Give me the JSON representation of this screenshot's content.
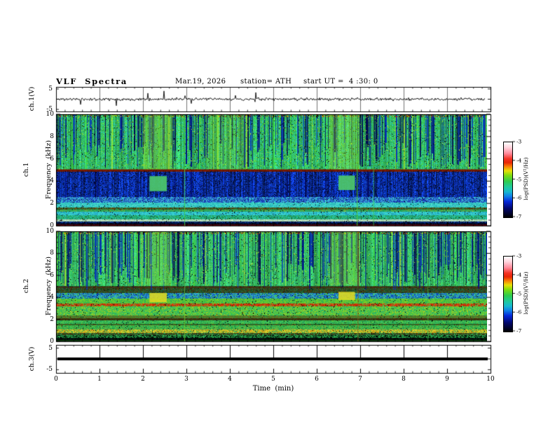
{
  "header": {
    "title": "VLF  Spectra",
    "date": "Mar.19, 2026",
    "station": "station= ATH",
    "start_ut": "start UT =  4 :30: 0"
  },
  "axes": {
    "time": {
      "label": "Time  (min)",
      "ticks": [
        0,
        1,
        2,
        3,
        4,
        5,
        6,
        7,
        8,
        9,
        10
      ],
      "minor_step": 0.2,
      "range": [
        0,
        10
      ]
    },
    "freq": {
      "ticks": [
        0,
        2,
        4,
        6,
        8,
        10
      ],
      "minor_step": 0.5,
      "range": [
        0,
        10
      ]
    },
    "volt": {
      "ticks": [
        5,
        -5
      ],
      "range": [
        -5,
        5
      ]
    },
    "wave_ylabel": "ch.1(V)",
    "spec1_ylabel1": "ch.1",
    "spec1_ylabel2": "Frequency  (kHz)",
    "spec2_ylabel1": "ch.2",
    "spec2_ylabel2": "Frequency  (kHz)",
    "ch3_ylabel": "ch.3(V)"
  },
  "colorbar": {
    "label": "log(PSD)(V²/Hz)",
    "ticks": [
      -3,
      -4,
      -5,
      -6,
      -7
    ],
    "range": [
      -7,
      -3
    ],
    "stops": [
      [
        0,
        "#ffffff"
      ],
      [
        0.07,
        "#ffd4dd"
      ],
      [
        0.15,
        "#ff8899"
      ],
      [
        0.22,
        "#f43325"
      ],
      [
        0.27,
        "#e82605"
      ],
      [
        0.32,
        "#f97a07"
      ],
      [
        0.38,
        "#e8e007"
      ],
      [
        0.44,
        "#7fdd0f"
      ],
      [
        0.52,
        "#2ecc4e"
      ],
      [
        0.6,
        "#1fc9a0"
      ],
      [
        0.66,
        "#17b8cf"
      ],
      [
        0.72,
        "#0f7fe8"
      ],
      [
        0.79,
        "#0527d9"
      ],
      [
        0.88,
        "#02086e"
      ],
      [
        1,
        "#000000"
      ]
    ]
  },
  "chart_data": [
    {
      "type": "line",
      "name": "ch1_voltage_waveform",
      "ylabel": "ch.1(V)",
      "y_ticks": [
        5,
        -5
      ],
      "x_range_min": [
        0,
        9.9
      ],
      "baseline_V": 0,
      "noise_amp_V": 0.9,
      "spike_prob": 0.013,
      "spike_max_V": 4.2,
      "color": "#000000",
      "seed": 11
    },
    {
      "type": "heatmap",
      "name": "ch1_spectrogram",
      "xlabel": "Time (min)",
      "ylabel": "ch.1 Frequency (kHz)",
      "zlabel": "log(PSD)(V²/Hz)",
      "x_range_min": [
        0,
        9.92
      ],
      "y_range_kHz": [
        0,
        10
      ],
      "z_range": [
        -7,
        -3
      ],
      "seed": 7,
      "bands": [
        {
          "f": [
            0,
            0.1
          ],
          "colors": [
            "#3a0500",
            "#1a0200",
            "#00031a",
            "#3a0500"
          ]
        },
        {
          "f": [
            0.1,
            0.28
          ],
          "colors": [
            "#000011",
            "#001133",
            "#001b55",
            "#000000",
            "#001144"
          ]
        },
        {
          "f": [
            0.28,
            0.44
          ],
          "colors": [
            "#001b55",
            "#0a2a77",
            "#113366",
            "#000022",
            "#1144aa"
          ]
        },
        {
          "f": [
            0.44,
            0.6
          ],
          "colors": [
            "#cfe8cf",
            "#b8ddb8",
            "#a0d4b0",
            "#8fcc9f"
          ]
        },
        {
          "f": [
            0.6,
            0.95
          ],
          "colors": [
            "#33bb66",
            "#22ccaa",
            "#16995c",
            "#2fb3a0",
            "#1f8855"
          ]
        },
        {
          "f": [
            0.95,
            1.3
          ],
          "colors": [
            "#35cfcf",
            "#27b3cf",
            "#3fd9cc",
            "#1f9eb8"
          ]
        },
        {
          "f": [
            1.3,
            1.48
          ],
          "colors": [
            "#2fae57",
            "#23a06e",
            "#6fae3f",
            "#1f9e50"
          ]
        },
        {
          "f": [
            1.48,
            1.66
          ],
          "colors": [
            "#6a5513",
            "#3a3a10",
            "#1f7a3a",
            "#513d12",
            "#2a8a4a"
          ]
        },
        {
          "f": [
            1.66,
            2.08
          ],
          "colors": [
            "#35cfcf",
            "#55dccc",
            "#27aabb",
            "#2fc9b8"
          ]
        },
        {
          "f": [
            2.08,
            2.62
          ],
          "colors": [
            "#2a62d9",
            "#1d3fb5",
            "#3fa9cf",
            "#10309e",
            "#35cfcf"
          ]
        },
        {
          "f": [
            2.62,
            4.9
          ],
          "colors": [
            "#0a28a8",
            "#071b78",
            "#1648cf",
            "#03103f",
            "#0a35c4",
            "#0f3fd0"
          ]
        },
        {
          "f": [
            4.9,
            5.06
          ],
          "colors": [
            "#6b1703",
            "#8a2507",
            "#451103"
          ]
        },
        {
          "f": [
            5.06,
            10
          ],
          "colors": [
            "#35c457",
            "#2bbb86",
            "#45cc49",
            "#33c9a5",
            "#2aa84f"
          ]
        }
      ],
      "green_zone": [
        5.06,
        10
      ],
      "deep_zone": [
        2.62,
        4.9
      ],
      "streaks": {
        "dark_prob": 0.3,
        "dark_colors": [
          "#001188",
          "#000052",
          "#0535bb"
        ],
        "start_range": [
          5.06,
          7.6
        ],
        "deep_extend_prob": 0.25,
        "bright_prob": 0.05,
        "bright_colors": [
          "#3ddd3d",
          "#a8e22a"
        ]
      },
      "hlines": [
        {
          "f": 5.0,
          "c": "#771803",
          "w": 2,
          "a": 0.85
        },
        {
          "f": 0.05,
          "c": "#550000",
          "w": 2,
          "a": 0.9
        }
      ],
      "full_lines": [
        {
          "t": 2.95,
          "c": "#44d04a",
          "a": 0.8
        },
        {
          "t": 6.92,
          "c": "#55cc33",
          "a": 0.8
        },
        {
          "t": 7.3,
          "c": "#3dc94a",
          "a": 0.6
        }
      ],
      "patches": [
        {
          "t": [
            2.15,
            2.55
          ],
          "f": [
            3.1,
            4.45
          ],
          "c": "#4ec96a",
          "a": 0.92
        },
        {
          "t": [
            6.5,
            6.88
          ],
          "f": [
            3.2,
            4.5
          ],
          "c": "#4ec96a",
          "a": 0.92
        },
        {
          "t": [
            2.02,
            2.68
          ],
          "f": [
            5.06,
            10
          ],
          "c": "#8fd83a",
          "a": 0.38
        },
        {
          "t": [
            6.28,
            6.98
          ],
          "f": [
            5.06,
            10
          ],
          "c": "#97dc3a",
          "a": 0.34
        },
        {
          "t": [
            3.45,
            4.35
          ],
          "f": [
            5.06,
            10
          ],
          "c": "#7ccf3f",
          "a": 0.25
        }
      ]
    },
    {
      "type": "heatmap",
      "name": "ch2_spectrogram",
      "xlabel": "Time (min)",
      "ylabel": "ch.2 Frequency (kHz)",
      "zlabel": "log(PSD)(V²/Hz)",
      "x_range_min": [
        0,
        9.92
      ],
      "y_range_kHz": [
        0,
        10
      ],
      "z_range": [
        -7,
        -3
      ],
      "seed": 13,
      "bands": [
        {
          "f": [
            0,
            0.38
          ],
          "colors": [
            "#000000",
            "#001122",
            "#002211",
            "#000000",
            "#0a1a00"
          ]
        },
        {
          "f": [
            0.38,
            0.6
          ],
          "colors": [
            "#229944",
            "#2fae57",
            "#115522",
            "#000000"
          ]
        },
        {
          "f": [
            0.6,
            0.78
          ],
          "colors": [
            "#3a3a10",
            "#225533",
            "#513d12",
            "#2fae57"
          ]
        },
        {
          "f": [
            0.78,
            1.12
          ],
          "colors": [
            "#c9c92a",
            "#e0d535",
            "#c98f16",
            "#a8b322",
            "#2fae57"
          ]
        },
        {
          "f": [
            1.12,
            1.5
          ],
          "colors": [
            "#2fae57",
            "#45cc49",
            "#229944",
            "#6fae3f"
          ]
        },
        {
          "f": [
            1.5,
            1.64
          ],
          "colors": [
            "#117733",
            "#2a6e2a",
            "#5a5518"
          ]
        },
        {
          "f": [
            1.64,
            1.96
          ],
          "colors": [
            "#2fae57",
            "#55cc44",
            "#35bb66",
            "#2a9e4a"
          ]
        },
        {
          "f": [
            1.96,
            2.14
          ],
          "colors": [
            "#513311",
            "#224411",
            "#3a2a08",
            "#2a6e3a"
          ]
        },
        {
          "f": [
            2.14,
            2.42
          ],
          "colors": [
            "#558833",
            "#447722",
            "#6e6e1f",
            "#2f8a3a"
          ]
        },
        {
          "f": [
            2.42,
            3.22
          ],
          "colors": [
            "#45cc49",
            "#66cc33",
            "#a8cc22",
            "#35bb55",
            "#2fae6e"
          ]
        },
        {
          "f": [
            3.22,
            3.44
          ],
          "colors": [
            "#d93508",
            "#c42a05",
            "#45cc49",
            "#a83005",
            "#e04a10"
          ]
        },
        {
          "f": [
            3.44,
            3.94
          ],
          "colors": [
            "#55cc33",
            "#88cc22",
            "#45bb45",
            "#2fae57"
          ]
        },
        {
          "f": [
            3.94,
            4.44
          ],
          "colors": [
            "#2795c9",
            "#1660c4",
            "#35b3c9",
            "#0a44a8",
            "#45cc49"
          ]
        },
        {
          "f": [
            4.44,
            5.08
          ],
          "colors": [
            "#225533",
            "#513311",
            "#114422",
            "#3a4411",
            "#2a6e3a"
          ]
        },
        {
          "f": [
            5.08,
            10
          ],
          "colors": [
            "#35c44f",
            "#45cc5f",
            "#2bb371",
            "#3fc98a",
            "#2fae57"
          ]
        }
      ],
      "green_zone": [
        5.08,
        10
      ],
      "streaks": {
        "dark_prob": 0.34,
        "dark_colors": [
          "#001488",
          "#000052",
          "#0535bb"
        ],
        "start_range": [
          4.6,
          7.2
        ],
        "deep_extend_prob": 0,
        "bright_prob": 0.05,
        "bright_colors": [
          "#3ddd3d",
          "#b8e22a"
        ]
      },
      "hlines": [
        {
          "f": 2.02,
          "c": "#402a08",
          "w": 2,
          "a": 0.7
        },
        {
          "f": 4.9,
          "c": "#5a1803",
          "w": 1,
          "a": 0.8
        },
        {
          "f": 0.06,
          "c": "#0a3a0a",
          "w": 2,
          "a": 0.9
        }
      ],
      "full_lines": [
        {
          "t": 2.95,
          "c": "#66cc33",
          "a": 0.7
        },
        {
          "t": 6.94,
          "c": "#8a6a1a",
          "a": 0.7
        },
        {
          "t": 8.55,
          "c": "#55cc44",
          "a": 0.5
        }
      ],
      "patches": [
        {
          "t": [
            2.15,
            2.55
          ],
          "f": [
            3.55,
            4.4
          ],
          "c": "#ddd822",
          "a": 0.9
        },
        {
          "t": [
            6.5,
            6.88
          ],
          "f": [
            3.75,
            4.5
          ],
          "c": "#ddd822",
          "a": 0.9
        },
        {
          "t": [
            2.05,
            2.65
          ],
          "f": [
            5.08,
            10
          ],
          "c": "#8fd83a",
          "a": 0.33
        },
        {
          "t": [
            6.3,
            6.95
          ],
          "f": [
            5.08,
            10
          ],
          "c": "#97dc3a",
          "a": 0.3
        }
      ]
    },
    {
      "type": "line",
      "name": "ch3_voltage_flat",
      "ylabel": "ch.3(V)",
      "y_ticks": [
        5,
        -5
      ],
      "x_range_min": [
        0,
        9.92
      ],
      "value_V": 0,
      "thickness_V": 1,
      "color": "#000000"
    }
  ]
}
